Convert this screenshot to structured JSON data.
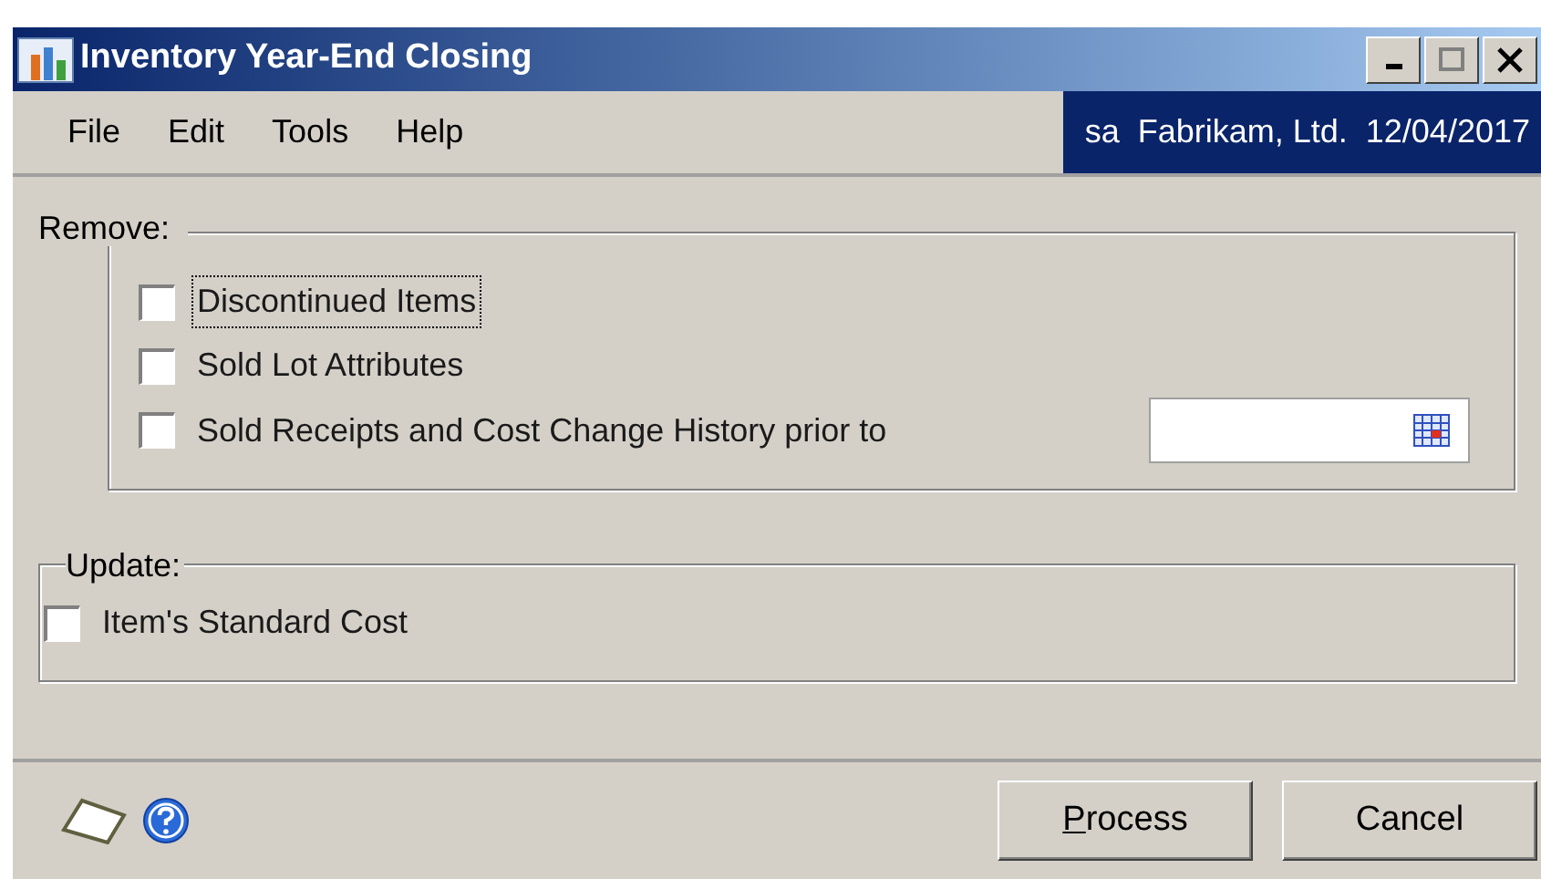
{
  "window": {
    "title": "Inventory Year-End Closing",
    "controls": [
      {
        "kind": "minimize",
        "disabled": false
      },
      {
        "kind": "maximize",
        "disabled": true
      },
      {
        "kind": "close",
        "disabled": false
      }
    ]
  },
  "menu": [
    "File",
    "Edit",
    "Tools",
    "Help"
  ],
  "user_info": "sa  Fabrikam, Ltd.  12/04/2017",
  "remove": {
    "label": "Remove:",
    "options": [
      {
        "label": "Discontinued Items",
        "checked": false,
        "focused": true
      },
      {
        "label": "Sold Lot Attributes",
        "checked": false,
        "focused": false
      },
      {
        "label": "Sold Receipts and Cost Change History prior to",
        "checked": false,
        "focused": false,
        "kind": "date"
      }
    ]
  },
  "update": {
    "label": "Update:",
    "options": [
      {
        "label": "Item's Standard Cost",
        "checked": false,
        "focused": false
      }
    ]
  },
  "buttons": [
    {
      "label": "Process",
      "mnemonic_first": true
    },
    {
      "label": "Cancel",
      "mnemonic_first": false
    }
  ]
}
